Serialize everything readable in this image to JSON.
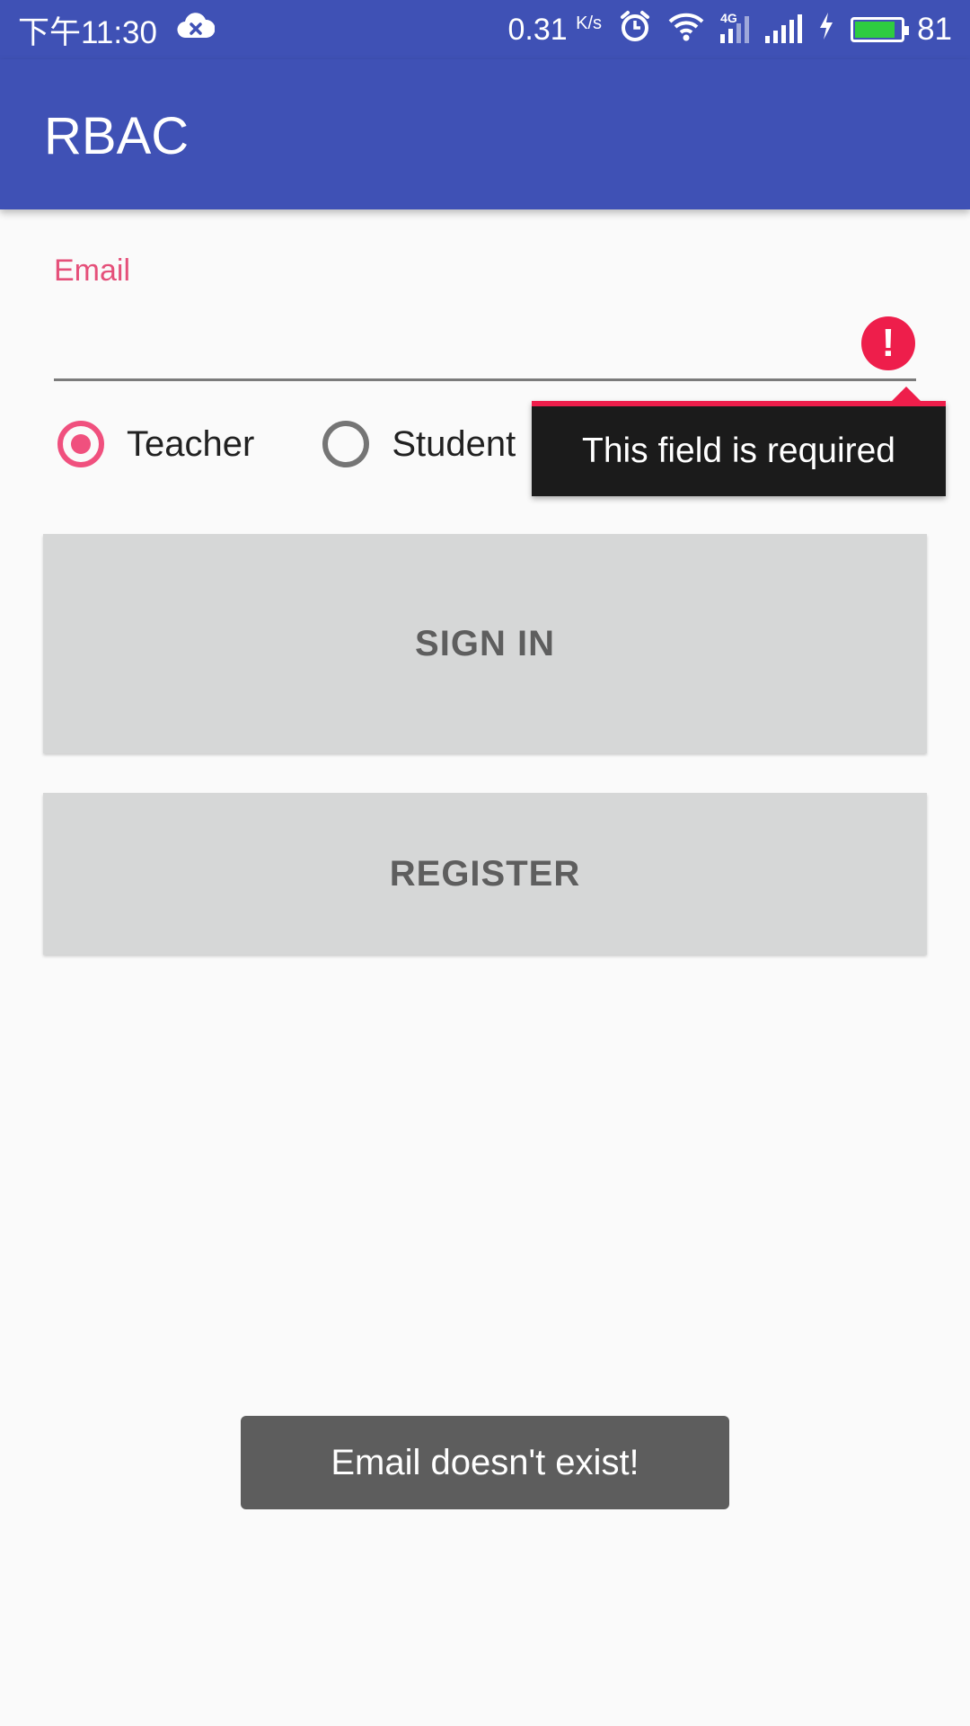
{
  "status_bar": {
    "time": "下午11:30",
    "speed": "0.31",
    "speed_unit": "K/s",
    "network_type": "4G",
    "battery_level": "81",
    "icons": [
      "cloud-x-icon",
      "alarm-icon",
      "wifi-icon",
      "signal-4g-icon",
      "signal-icon",
      "charging-icon",
      "battery-icon"
    ]
  },
  "app_bar": {
    "title": "RBAC"
  },
  "form": {
    "email_label": "Email",
    "email_value": "",
    "error_icon": "!",
    "error_message": "This field is required",
    "roles": [
      {
        "label": "Teacher",
        "checked": true
      },
      {
        "label": "Student",
        "checked": false
      }
    ],
    "sign_in_label": "SIGN IN",
    "register_label": "REGISTER"
  },
  "toast": {
    "message": "Email doesn't exist!"
  },
  "colors": {
    "primary": "#3f51b5",
    "accent": "#f0507e",
    "error": "#ee1e4b",
    "button_bg": "#d6d7d7"
  }
}
